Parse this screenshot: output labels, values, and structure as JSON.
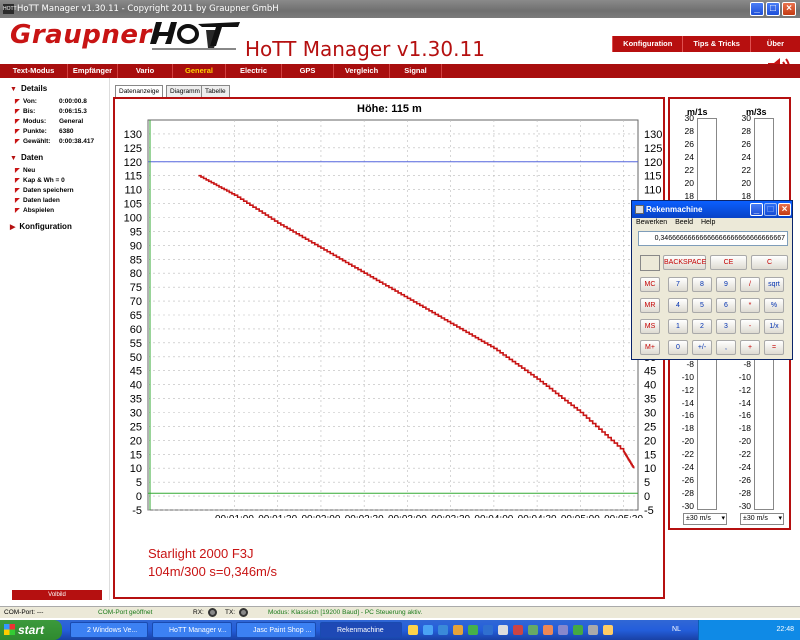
{
  "window": {
    "title": "HoTT Manager v1.30.11 - Copyright 2011 by Graupner GmbH",
    "icon_label": "HOTT"
  },
  "header": {
    "brand": "Graupner",
    "app_title": "HoTT Manager v1.30.11",
    "topnav": [
      "Konfiguration",
      "Tips & Tricks",
      "Über"
    ]
  },
  "menu": {
    "items": [
      "Text-Modus",
      "Empfänger",
      "Vario",
      "General",
      "Electric",
      "GPS",
      "Vergleich",
      "Signal"
    ],
    "active": "General"
  },
  "left": {
    "details_title": "Details",
    "details": [
      {
        "k": "Von:",
        "v": "0:00:00.8"
      },
      {
        "k": "Bis:",
        "v": "0:06:15.3"
      },
      {
        "k": "Modus:",
        "v": "General"
      },
      {
        "k": "Punkte:",
        "v": "6380"
      },
      {
        "k": "Gewählt:",
        "v": "0:00:38.417"
      }
    ],
    "daten_title": "Daten",
    "daten": [
      "Neu",
      "Kap & Wh = 0",
      "Daten speichern",
      "Daten laden",
      "Abspielen"
    ],
    "konfig_title": "Konfiguration",
    "volbild": "Volbild"
  },
  "tabs": [
    "Datenanzeige",
    "Diagramm",
    "Tabelle"
  ],
  "chart_data": {
    "type": "line",
    "title": "Höhe: 115 m",
    "ylim": [
      -5,
      135
    ],
    "yticks": [
      130,
      125,
      120,
      115,
      110,
      105,
      100,
      95,
      90,
      85,
      80,
      75,
      70,
      65,
      60,
      55,
      50,
      45,
      40,
      35,
      30,
      25,
      20,
      15,
      10,
      5,
      0,
      -5
    ],
    "xticks": [
      "00:01:00",
      "00:01:30",
      "00:02:00",
      "00:02:30",
      "00:03:00",
      "00:03:30",
      "00:04:00",
      "00:04:30",
      "00:05:00",
      "00:05:30"
    ],
    "x": [
      35,
      60,
      90,
      120,
      150,
      180,
      210,
      240,
      270,
      300,
      330,
      337
    ],
    "y": [
      115,
      108,
      98,
      89,
      80,
      71,
      62,
      53,
      42,
      30,
      16,
      10
    ],
    "hlines": [
      {
        "y": 120,
        "color": "#5566dd"
      },
      {
        "y": 1,
        "color": "#33aa33"
      }
    ],
    "series_color": "#c81414"
  },
  "notes": [
    "Starlight 2000 F3J",
    "104m/300 s=0,346m/s"
  ],
  "vario": {
    "labels": [
      "m/1s",
      "m/3s"
    ],
    "scale": [
      30,
      28,
      26,
      24,
      22,
      20,
      18,
      16,
      14,
      12,
      10,
      8,
      6,
      4,
      2,
      0,
      -2,
      -4,
      -6,
      -8,
      -10,
      -12,
      -14,
      -16,
      -18,
      -20,
      -22,
      -24,
      -26,
      -28,
      -30
    ],
    "select": [
      "±30 m/s",
      "±30 m/s"
    ]
  },
  "calculator": {
    "title": "Rekenmachine",
    "menu": [
      "Bewerken",
      "Beeld",
      "Help"
    ],
    "display": "0,34666666666666666666666666666667",
    "buttons": {
      "row0": [
        "BACKSPACE",
        "CE",
        "C"
      ],
      "mem": [
        "MC",
        "MR",
        "MS",
        "M+"
      ],
      "grid": [
        [
          "7",
          "8",
          "9",
          "/",
          "sqrt"
        ],
        [
          "4",
          "5",
          "6",
          "*",
          "%"
        ],
        [
          "1",
          "2",
          "3",
          "-",
          "1/x"
        ],
        [
          "0",
          "+/-",
          ",",
          "+",
          "="
        ]
      ]
    }
  },
  "status": {
    "com": "COM-Port: ---",
    "geoffnet": "COM-Port geöffnet",
    "rx": "RX:",
    "tx": "TX:",
    "modus": "Modus: Klassisch [19200 Baud] - PC Steuerung aktiv."
  },
  "taskbar": {
    "start": "start",
    "buttons": [
      "2 Windows Ve...",
      "HoTT Manager v...",
      "Jasc Paint Shop ...",
      "Rekenmachine"
    ],
    "lang": "NL",
    "time": "22:48"
  }
}
